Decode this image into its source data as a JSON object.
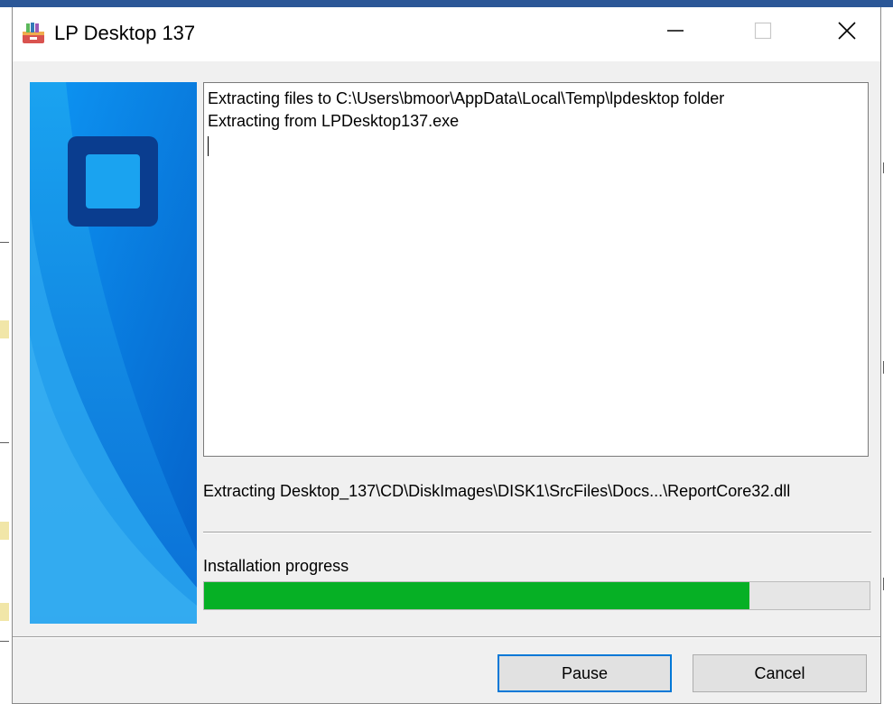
{
  "window": {
    "title": "LP Desktop 137",
    "icon": "winrar-archive-icon",
    "controls": [
      "minimize-icon",
      "maximize-icon",
      "close-icon"
    ]
  },
  "log": {
    "lines": [
      "Extracting files to C:\\Users\\bmoor\\AppData\\Local\\Temp\\lpdesktop folder",
      "Extracting from LPDesktop137.exe"
    ]
  },
  "status": {
    "current_file": "Extracting Desktop_137\\CD\\DiskImages\\DISK1\\SrcFiles\\Docs...\\ReportCore32.dll"
  },
  "progress": {
    "label": "Installation progress",
    "fraction": 0.819
  },
  "buttons": {
    "pause": "Pause",
    "cancel": "Cancel"
  },
  "colors": {
    "progress_fill": "#06b025",
    "banner_blue": "#0a7de0",
    "default_button_border": "#0078d7"
  }
}
